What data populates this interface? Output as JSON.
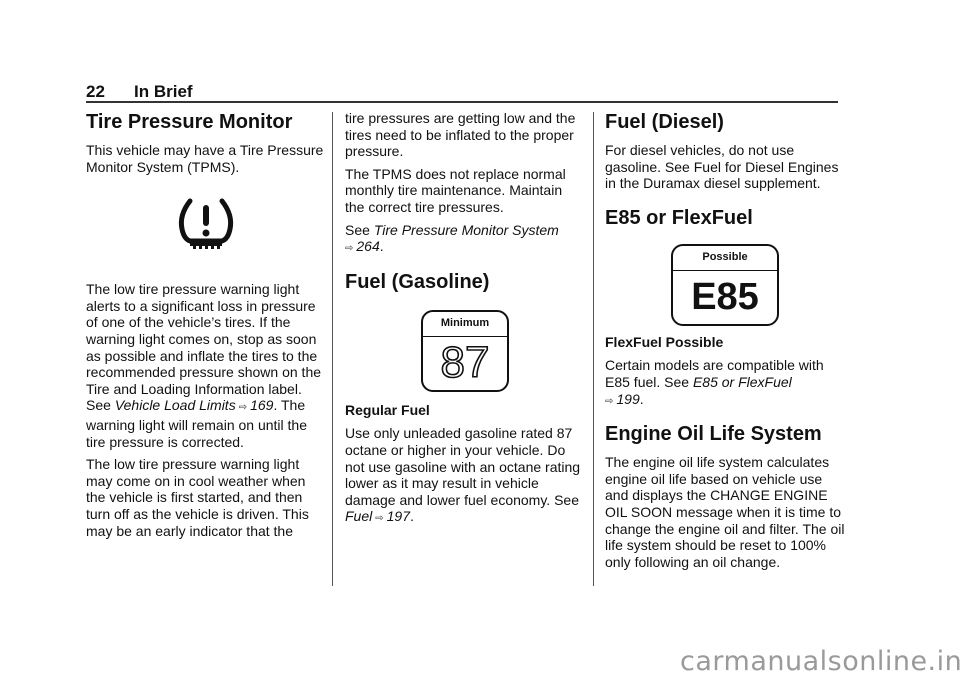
{
  "header": {
    "page_number": "22",
    "section": "In Brief"
  },
  "col1": {
    "title": "Tire Pressure Monitor",
    "intro": "This vehicle may have a Tire Pressure Monitor System (TPMS).",
    "icon": "tire-pressure-warning-icon",
    "para1_text": "The low tire pressure warning light alerts to a significant loss in pressure of one of the vehicle’s tires. If the warning light comes on, stop as soon as possible and inflate the tires to the recommended pressure shown on the Tire and Loading Information label. See ",
    "para1_link": "Vehicle Load Limits",
    "para1_page": "169",
    "para1_tail": ". The warning light will remain on until the tire pressure is corrected.",
    "para2": "The low tire pressure warning light may come on in cool weather when the vehicle is first started, and then turn off as the vehicle is driven. This may be an early indicator that the"
  },
  "col2": {
    "cont": "tire pressures are getting low and the tires need to be inflated to the proper pressure.",
    "tpms_note": "The TPMS does not replace normal monthly tire maintenance. Maintain the correct tire pressures.",
    "see_label": "See ",
    "see_link": "Tire Pressure Monitor System",
    "see_page": "264",
    "fuel_title": "Fuel (Gasoline)",
    "badge_top": "Minimum",
    "badge_value": "87",
    "caption": "Regular Fuel",
    "body": "Use only unleaded gasoline rated 87 octane or higher in your vehicle. Do not use gasoline with an octane rating lower as it may result in vehicle damage and lower fuel economy. See ",
    "body_link": "Fuel",
    "body_page": "197"
  },
  "col3": {
    "diesel_title": "Fuel (Diesel)",
    "diesel_body": "For diesel vehicles, do not use gasoline. See  Fuel for Diesel Engines  in the Duramax diesel supplement.",
    "e85_title": "E85 or FlexFuel",
    "badge_top": "Possible",
    "badge_value": "E85",
    "caption": "FlexFuel Possible",
    "e85_body": "Certain models are compatible with E85 fuel. See ",
    "e85_link": "E85 or FlexFuel",
    "e85_page": "199",
    "oil_title": "Engine Oil Life System",
    "oil_body": "The engine oil life system calculates engine oil life based on vehicle use and displays the CHANGE ENGINE OIL SOON message when it is time to change the engine oil and filter. The oil life system should be reset to 100% only following an oil change."
  },
  "xref_glyph": "⇨",
  "watermark": "carmanualsonline.info"
}
